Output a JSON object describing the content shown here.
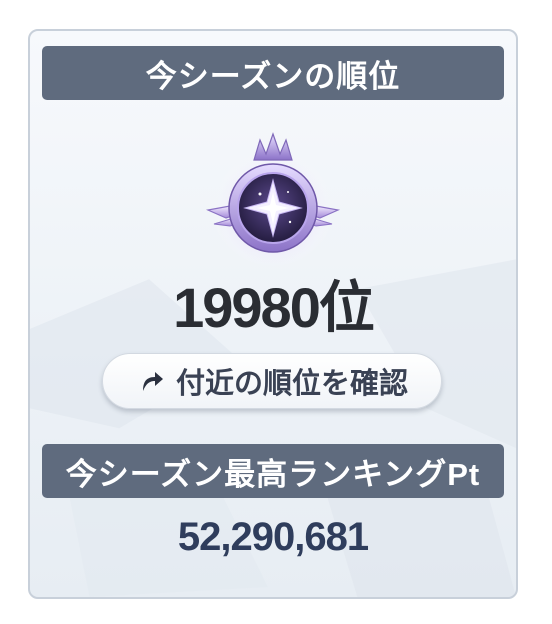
{
  "season_rank": {
    "title": "今シーズンの順位",
    "rank_text": "19980位",
    "nearby_button_label": "付近の順位を確認"
  },
  "season_best": {
    "title": "今シーズン最高ランキングPt",
    "points": "52,290,681"
  },
  "icons": {
    "rank_emblem": "star-compass-medal-icon",
    "nearby_arrow": "curved-arrow-icon"
  },
  "colors": {
    "header_bar": "#5f6b7e",
    "header_text": "#ffffff",
    "rank_text": "#2a2d33",
    "points_text": "#2f3d5c",
    "emblem_purple": "#8f7cc9"
  }
}
